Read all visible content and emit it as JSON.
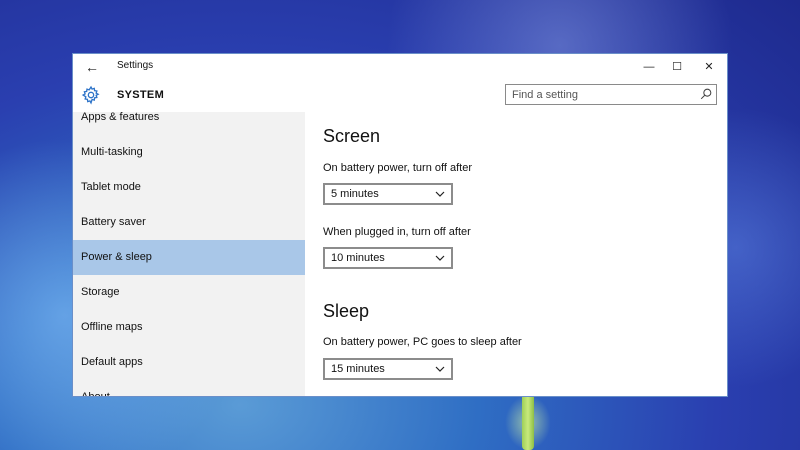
{
  "window": {
    "title": "Settings",
    "controls": {
      "minimize": "—",
      "maximize": "☐",
      "close": "✕"
    },
    "back_glyph": "←"
  },
  "header": {
    "title": "SYSTEM",
    "icon": "gear-icon"
  },
  "search": {
    "placeholder": "Find a setting",
    "value": "",
    "icon": "search-icon"
  },
  "sidebar": {
    "items": [
      {
        "label": "Apps & features",
        "selected": false
      },
      {
        "label": "Multi-tasking",
        "selected": false
      },
      {
        "label": "Tablet mode",
        "selected": false
      },
      {
        "label": "Battery saver",
        "selected": false
      },
      {
        "label": "Power & sleep",
        "selected": true
      },
      {
        "label": "Storage",
        "selected": false
      },
      {
        "label": "Offline maps",
        "selected": false
      },
      {
        "label": "Default apps",
        "selected": false
      },
      {
        "label": "About",
        "selected": false
      }
    ]
  },
  "content": {
    "screen": {
      "title": "Screen",
      "battery_label": "On battery power, turn off after",
      "battery_value": "5 minutes",
      "plugged_label": "When plugged in, turn off after",
      "plugged_value": "10 minutes"
    },
    "sleep": {
      "title": "Sleep",
      "battery_label": "On battery power, PC goes to sleep after",
      "battery_value": "15 minutes"
    }
  },
  "colors": {
    "accent": "#2d73c8",
    "selected_item": "#a9c7e8",
    "sidebar_bg": "#f2f2f2"
  }
}
